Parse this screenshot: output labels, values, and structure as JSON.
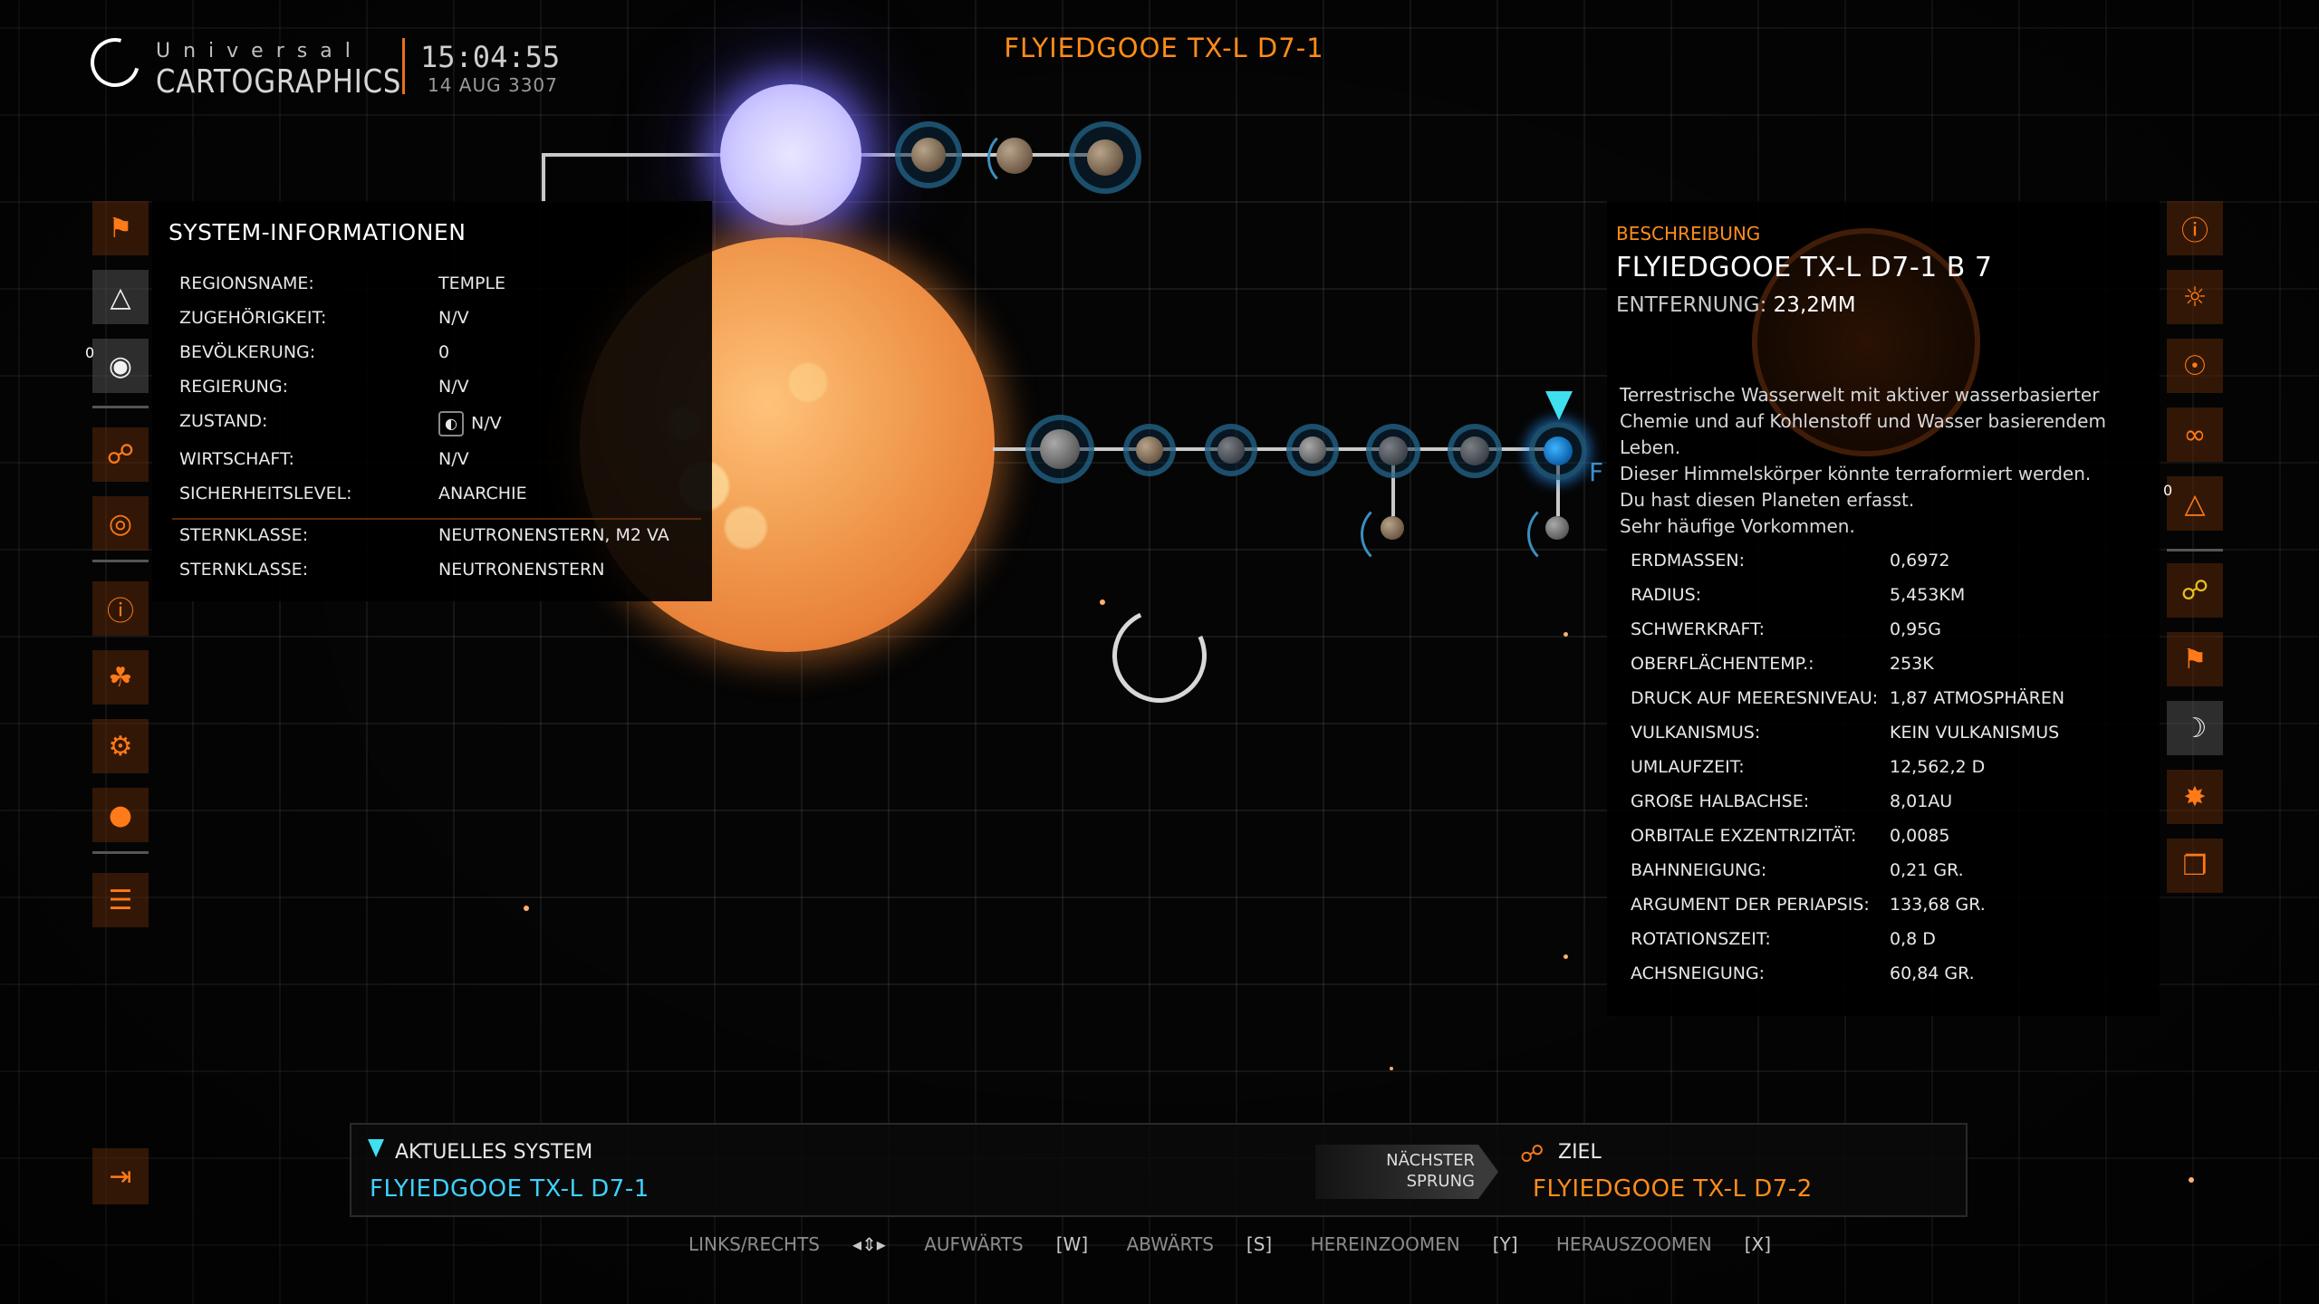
{
  "header": {
    "logo_small": "Universal",
    "logo_big": "CARTOGRAPHICS",
    "time": "15:04:55",
    "date": "14 AUG 3307",
    "system_title": "FLYIEDGOOE TX-L D7-1"
  },
  "left_icons": [
    {
      "icon": "bookmark-icon"
    },
    {
      "icon": "terrain-icon"
    },
    {
      "icon": "globe-icon",
      "count": "0"
    },
    {
      "icon": "route-icon"
    },
    {
      "icon": "target-globe-icon"
    },
    {
      "icon": "info-icon"
    },
    {
      "icon": "government-icon"
    },
    {
      "icon": "gear-icon"
    },
    {
      "icon": "location-icon"
    },
    {
      "icon": "list-icon"
    }
  ],
  "system_info": {
    "title": "SYSTEM-INFORMATIONEN",
    "rows": [
      {
        "label": "REGIONSNAME:",
        "value": "TEMPLE"
      },
      {
        "label": "ZUGEHÖRIGKEIT:",
        "value": "N/V"
      },
      {
        "label": "BEVÖLKERUNG:",
        "value": "0"
      },
      {
        "label": "REGIERUNG:",
        "value": "N/V"
      },
      {
        "label": "ZUSTAND:",
        "value": "N/V"
      },
      {
        "label": "WIRTSCHAFT:",
        "value": "N/V"
      },
      {
        "label": "SICHERHEITSLEVEL:",
        "value": "ANARCHIE"
      }
    ],
    "star_rows": [
      {
        "label": "STERNKLASSE:",
        "value": "NEUTRONENSTERN, M2 VA"
      },
      {
        "label": "STERNKLASSE:",
        "value": "NEUTRONENSTERN"
      }
    ]
  },
  "body_marker_label": "F",
  "description": {
    "header": "BESCHREIBUNG",
    "name": "FLYIEDGOOE TX-L D7-1 B 7",
    "distance_label": "ENTFERNUNG:",
    "distance_value": "23,2MM",
    "text_lines": [
      "Terrestrische Wasserwelt mit aktiver wasserbasierter",
      "Chemie und auf Kohlenstoff und Wasser basierendem",
      "Leben.",
      "Dieser Himmelskörper könnte terraformiert werden.",
      "Du hast diesen Planeten erfasst.",
      "Sehr häufige Vorkommen."
    ],
    "rows": [
      {
        "label": "ERDMASSEN:",
        "value": "0,6972"
      },
      {
        "label": "RADIUS:",
        "value": "5,453KM"
      },
      {
        "label": "SCHWERKRAFT:",
        "value": "0,95G"
      },
      {
        "label": "OBERFLÄCHENTEMP.:",
        "value": "253K"
      },
      {
        "label": "DRUCK AUF MEERESNIVEAU:",
        "value": "1,87 ATMOSPHÄREN"
      },
      {
        "label": "VULKANISMUS:",
        "value": "KEIN VULKANISMUS"
      },
      {
        "label": "UMLAUFZEIT:",
        "value": "12,562,2 D"
      },
      {
        "label": "GROẞE HALBACHSE:",
        "value": "8,01AU"
      },
      {
        "label": "ORBITALE EXZENTRIZITÄT:",
        "value": "0,0085"
      },
      {
        "label": "BAHNNEIGUNG:",
        "value": "0,21 GR."
      },
      {
        "label": "ARGUMENT DER PERIAPSIS:",
        "value": "133,68 GR."
      },
      {
        "label": "ROTATIONSZEIT:",
        "value": "0,8 D"
      },
      {
        "label": "ACHSNEIGUNG:",
        "value": "60,84 GR."
      }
    ]
  },
  "right_icons": [
    {
      "icon": "planet-info-icon"
    },
    {
      "icon": "scan-icon"
    },
    {
      "icon": "star-icon"
    },
    {
      "icon": "dna-icon"
    },
    {
      "icon": "terrain-icon",
      "count": "0"
    },
    {
      "icon": "network-icon"
    },
    {
      "icon": "bookmark-add-icon"
    },
    {
      "icon": "moon-icon"
    },
    {
      "icon": "nodes-icon"
    },
    {
      "icon": "copy-icon"
    }
  ],
  "bottom": {
    "current_label": "AKTUELLES SYSTEM",
    "current_value": "FLYIEDGOOE TX-L D7-1",
    "next_jump_line1": "NÄCHSTER",
    "next_jump_line2": "SPRUNG",
    "target_label": "ZIEL",
    "target_value": "FLYIEDGOOE TX-L D7-2"
  },
  "hints": [
    {
      "label": "LINKS/RECHTS",
      "key": "◂⇕▸"
    },
    {
      "label": "AUFWÄRTS",
      "key": "[W]"
    },
    {
      "label": "ABWÄRTS",
      "key": "[S]"
    },
    {
      "label": "HEREINZOOMEN",
      "key": "[Y]"
    },
    {
      "label": "HERAUSZOOMEN",
      "key": "[X]"
    }
  ],
  "colors": {
    "accent_orange": "#ff8c1a",
    "accent_cyan": "#3fd0ff"
  }
}
